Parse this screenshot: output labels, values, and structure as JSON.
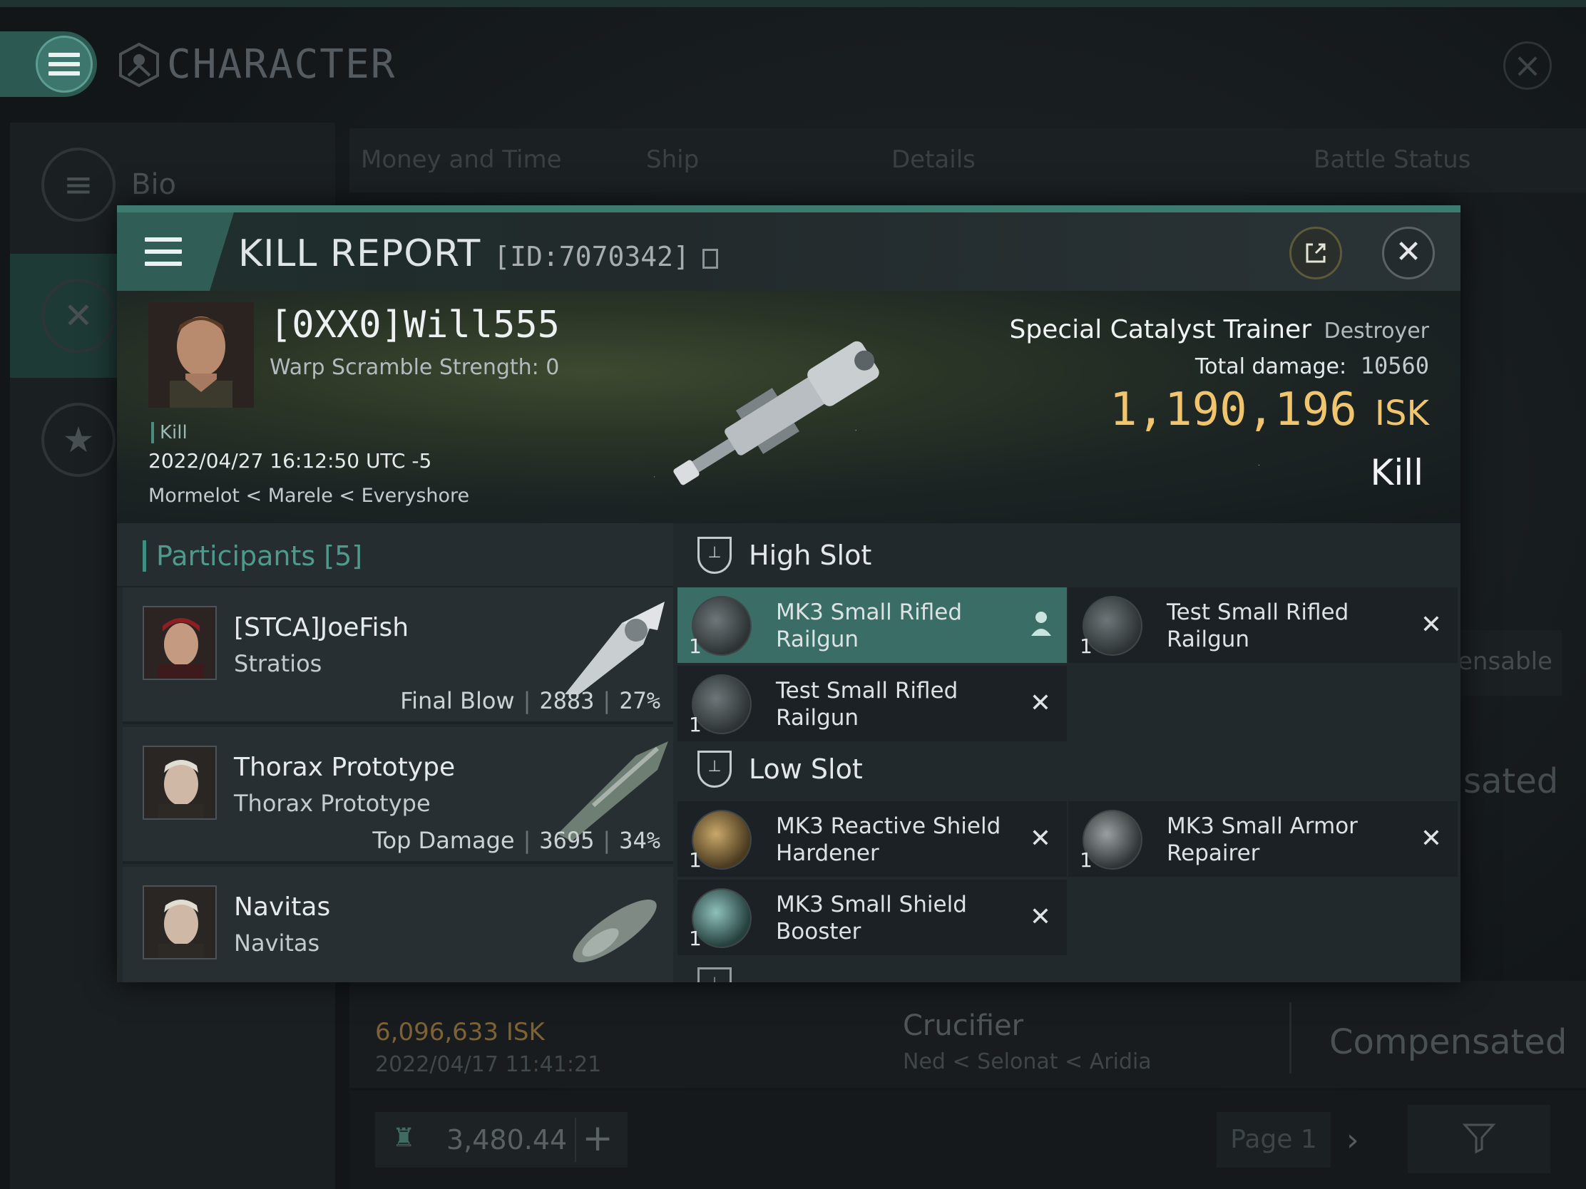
{
  "background": {
    "window_title": "CHARACTER",
    "sidebar": {
      "items": [
        {
          "label": "Bio",
          "icon": "menu-icon"
        },
        {
          "label": "",
          "icon": "crossed-swords-icon"
        },
        {
          "label": "",
          "icon": "star-icon"
        }
      ]
    },
    "tabs": [
      "Money and Time",
      "Ship",
      "Details",
      "Battle Status"
    ],
    "partial_texts": {
      "ensable": "ensable",
      "sated": "sated"
    },
    "loss_row": {
      "isk": "6,096,633 ISK",
      "date": "2022/04/17  11:41:21",
      "ship": "Crucifier",
      "location": "Ned < Selonat < Aridia",
      "status": "Compensated"
    },
    "footer": {
      "wallet": "3,480.44",
      "page": "Page 1"
    }
  },
  "kill_report": {
    "title": "KILL REPORT",
    "id": "[ID:7070342]",
    "victim": {
      "name": "[0XX0]Will555",
      "warp_scramble": "Warp Scramble Strength: 0",
      "tag": "Kill",
      "datetime": "2022/04/27 16:12:50 UTC -5",
      "location": "Mormelot < Marele < Everyshore",
      "ship": "Special Catalyst Trainer",
      "ship_class": "Destroyer",
      "total_damage_label": "Total damage:",
      "total_damage": "10560",
      "isk_value": "1,190,196",
      "isk_unit": "ISK",
      "status": "Kill"
    },
    "participants": {
      "label": "Participants [5]",
      "rows": [
        {
          "name": "[STCA]JoeFish",
          "ship": "Stratios",
          "stat_label": "Final Blow",
          "damage": "2883",
          "percent": "27%"
        },
        {
          "name": "Thorax Prototype",
          "ship": "Thorax Prototype",
          "stat_label": "Top Damage",
          "damage": "3695",
          "percent": "34%"
        },
        {
          "name": "Navitas",
          "ship": "Navitas",
          "stat_label": "",
          "damage": "",
          "percent": ""
        }
      ]
    },
    "fitting": {
      "high_slot_label": "High Slot",
      "low_slot_label": "Low Slot",
      "high": [
        {
          "name": "MK3 Small Rifled Railgun",
          "qty": "1",
          "state": "selected"
        },
        {
          "name": "Test Small Rifled Railgun",
          "qty": "1",
          "state": "destroyed"
        },
        {
          "name": "Test Small Rifled Railgun",
          "qty": "1",
          "state": "destroyed"
        }
      ],
      "low": [
        {
          "name": "MK3 Reactive Shield Hardener",
          "qty": "1",
          "state": "destroyed"
        },
        {
          "name": "MK3 Small Armor Repairer",
          "qty": "1",
          "state": "destroyed"
        },
        {
          "name": "MK3 Small Shield Booster",
          "qty": "1",
          "state": "destroyed"
        }
      ]
    }
  },
  "colors": {
    "accent": "#3d7a70",
    "isk": "#f0c56e",
    "selected_module": "#3a6d65"
  }
}
